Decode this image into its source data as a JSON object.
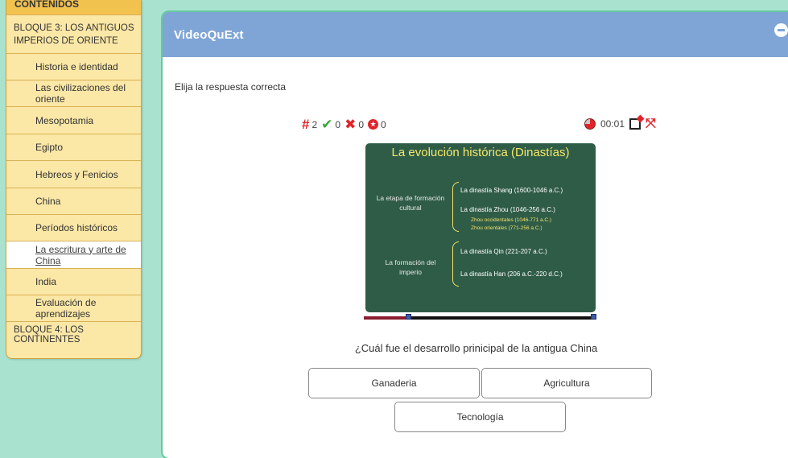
{
  "sidebar": {
    "header": "CONTENIDOS",
    "items": [
      {
        "label": "BLOQUE 3: LOS ANTIGUOS IMPERIOS DE ORIENTE",
        "level": "block"
      },
      {
        "label": "Historia e identidad",
        "level": "sub"
      },
      {
        "label": "Las civilizaciones del oriente",
        "level": "sub"
      },
      {
        "label": "Mesopotamia",
        "level": "sub"
      },
      {
        "label": "Egipto",
        "level": "sub"
      },
      {
        "label": "Hebreos y Fenicios",
        "level": "sub"
      },
      {
        "label": "China",
        "level": "sub"
      },
      {
        "label": "Períodos históricos",
        "level": "sub"
      },
      {
        "label": "La escritura y arte de China",
        "level": "sub",
        "active": true
      },
      {
        "label": "India",
        "level": "sub"
      },
      {
        "label": "Evaluación de aprendizajes",
        "level": "sub"
      },
      {
        "label": "BLOQUE 4: LOS CONTINENTES",
        "level": "block"
      }
    ]
  },
  "card": {
    "title": "VideoQuExt",
    "instructions": "Elija la respuesta correcta"
  },
  "score": {
    "questions": "2",
    "correct": "0",
    "incorrect": "0",
    "score": "0"
  },
  "timer": "00:01",
  "video": {
    "title": "La evolución histórica (Dinastías)",
    "group1_label": "La etapa de formación cultural",
    "group2_label": "La formación del imperio",
    "lines": [
      "La dinastía Shang (1600-1046 a.C.)",
      "La dinastía Zhou (1046-256 a.C.)",
      "La dinastía Qin (221-207 a.C.)",
      "La dinastía Han (206 a.C.-220 d.C.)"
    ],
    "sublines": [
      "Zhou occidentales (1046-771 a.C.)",
      "Zhou orientales (771-256 a.C.)"
    ],
    "progress": 0.19
  },
  "question": "¿Cuál fue el desarrollo prinicipal de la antigua China",
  "answers": [
    "Ganaderia",
    "Agricultura",
    "Tecnología"
  ],
  "colors": {
    "header_blue": "#7fa5d6",
    "sidebar_bg": "#fbe7a6",
    "page_bg": "#a9e3cf",
    "board_green": "#2f5c47"
  },
  "icons": {
    "questions": "hash-icon",
    "correct": "check-icon",
    "incorrect": "cross-icon",
    "score": "score-icon",
    "timer": "clock-icon",
    "exit": "exit-icon",
    "fullscreen": "fullscreen-icon"
  }
}
